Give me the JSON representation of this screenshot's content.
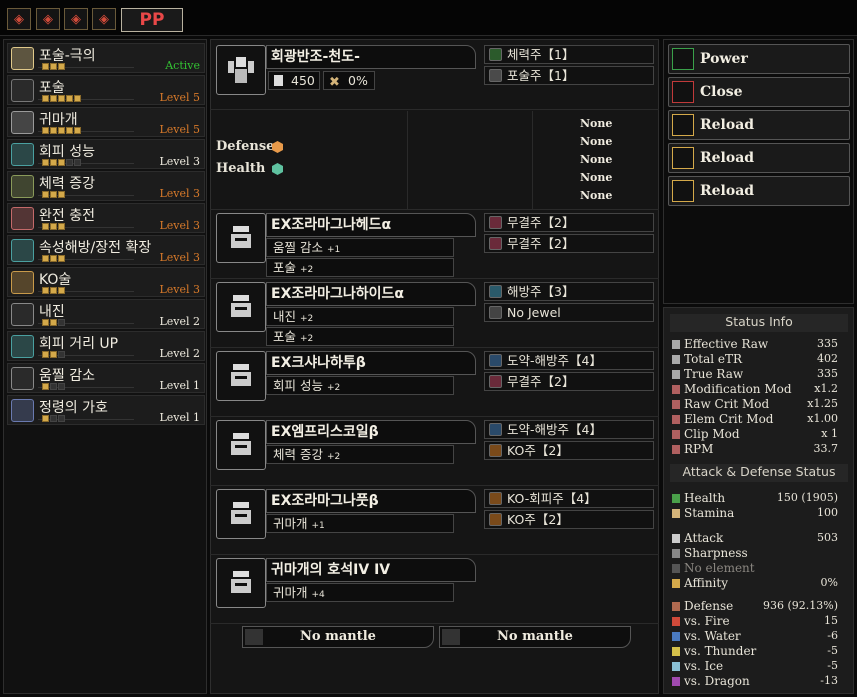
{
  "top_icons": [
    "monster-icon-1",
    "monster-icon-2",
    "monster-icon-3",
    "monster-icon-4"
  ],
  "top_tab": "PP",
  "skills": [
    {
      "name": "포술-극의",
      "level": "Active",
      "pips": 3,
      "max": 3,
      "level_color": "#33c233"
    },
    {
      "name": "포술",
      "level": "Level 5",
      "pips": 5,
      "max": 5,
      "level_color": "#d87a2a"
    },
    {
      "name": "귀마개",
      "level": "Level 5",
      "pips": 5,
      "max": 5,
      "level_color": "#d87a2a"
    },
    {
      "name": "회피 성능",
      "level": "Level 3",
      "pips": 3,
      "max": 5,
      "level_color": "#f0ece0"
    },
    {
      "name": "체력 증강",
      "level": "Level 3",
      "pips": 3,
      "max": 3,
      "level_color": "#d87a2a"
    },
    {
      "name": "완전 충전",
      "level": "Level 3",
      "pips": 3,
      "max": 3,
      "level_color": "#d87a2a"
    },
    {
      "name": "속성해방/장전 확장",
      "level": "Level 3",
      "pips": 3,
      "max": 3,
      "level_color": "#d87a2a"
    },
    {
      "name": "KO술",
      "level": "Level 3",
      "pips": 3,
      "max": 3,
      "level_color": "#d87a2a"
    },
    {
      "name": "내진",
      "level": "Level 2",
      "pips": 2,
      "max": 3,
      "level_color": "#f0ece0"
    },
    {
      "name": "회피 거리 UP",
      "level": "Level 2",
      "pips": 2,
      "max": 3,
      "level_color": "#f0ece0"
    },
    {
      "name": "움찔 감소",
      "level": "Level 1",
      "pips": 1,
      "max": 3,
      "level_color": "#f0ece0"
    },
    {
      "name": "정령의 가호",
      "level": "Level 1",
      "pips": 1,
      "max": 3,
      "level_color": "#f0ece0"
    }
  ],
  "weapon": {
    "name": "회광반조-천도-",
    "attack": "450",
    "affinity": "0%",
    "decos": [
      "체력주【1】",
      "포술주【1】"
    ],
    "defense_label": "Defense",
    "health_label": "Health",
    "none_list": [
      "None",
      "None",
      "None",
      "None",
      "None"
    ]
  },
  "armor": [
    {
      "name": "EX조라마그나헤드α",
      "skills": [
        [
          "움찔 감소",
          "+1"
        ],
        [
          "포술",
          "+2"
        ]
      ],
      "decos": [
        "무결주【2】",
        "무결주【2】"
      ]
    },
    {
      "name": "EX조라마그나하이드α",
      "skills": [
        [
          "내진",
          "+2"
        ],
        [
          "포술",
          "+2"
        ]
      ],
      "decos": [
        "해방주【3】",
        "No Jewel"
      ]
    },
    {
      "name": "EX크샤나하투β",
      "skills": [
        [
          "회피 성능",
          "+2"
        ]
      ],
      "decos": [
        "도약-해방주【4】",
        "무결주【2】"
      ]
    },
    {
      "name": "EX엠프리스코일β",
      "skills": [
        [
          "체력 증강",
          "+2"
        ]
      ],
      "decos": [
        "도약-해방주【4】",
        "KO주【2】"
      ]
    },
    {
      "name": "EX조라마그나풋β",
      "skills": [
        [
          "귀마개",
          "+1"
        ]
      ],
      "decos": [
        "KO-회피주【4】",
        "KO주【2】"
      ]
    },
    {
      "name": "귀마개의 호석IV IV",
      "skills": [
        [
          "귀마개",
          "+4"
        ]
      ],
      "decos": []
    }
  ],
  "mantles": [
    "No mantle",
    "No mantle"
  ],
  "actions": [
    "Power",
    "Close",
    "Reload",
    "Reload",
    "Reload"
  ],
  "status": {
    "head1": "Status Info",
    "rows1": [
      [
        "Effective Raw",
        "335"
      ],
      [
        "Total eTR",
        "402"
      ],
      [
        "True Raw",
        "335"
      ],
      [
        "Modification Mod",
        "x1.2"
      ],
      [
        "Raw Crit Mod",
        "x1.25"
      ],
      [
        "Elem Crit Mod",
        "x1.00"
      ],
      [
        "Clip Mod",
        "x 1"
      ],
      [
        "RPM",
        "33.7"
      ]
    ],
    "head2": "Attack & Defense Status",
    "health": [
      "Health",
      "150 (1905)"
    ],
    "stamina": [
      "Stamina",
      "100"
    ],
    "attack": [
      "Attack",
      "503"
    ],
    "sharpness": "Sharpness",
    "element": "No element",
    "affinity": [
      "Affinity",
      "0%"
    ],
    "defense": [
      "Defense",
      "936 (92.13%)"
    ],
    "resist": [
      [
        "vs. Fire",
        "15"
      ],
      [
        "vs. Water",
        "-6"
      ],
      [
        "vs. Thunder",
        "-5"
      ],
      [
        "vs. Ice",
        "-5"
      ],
      [
        "vs. Dragon",
        "-13"
      ]
    ]
  }
}
